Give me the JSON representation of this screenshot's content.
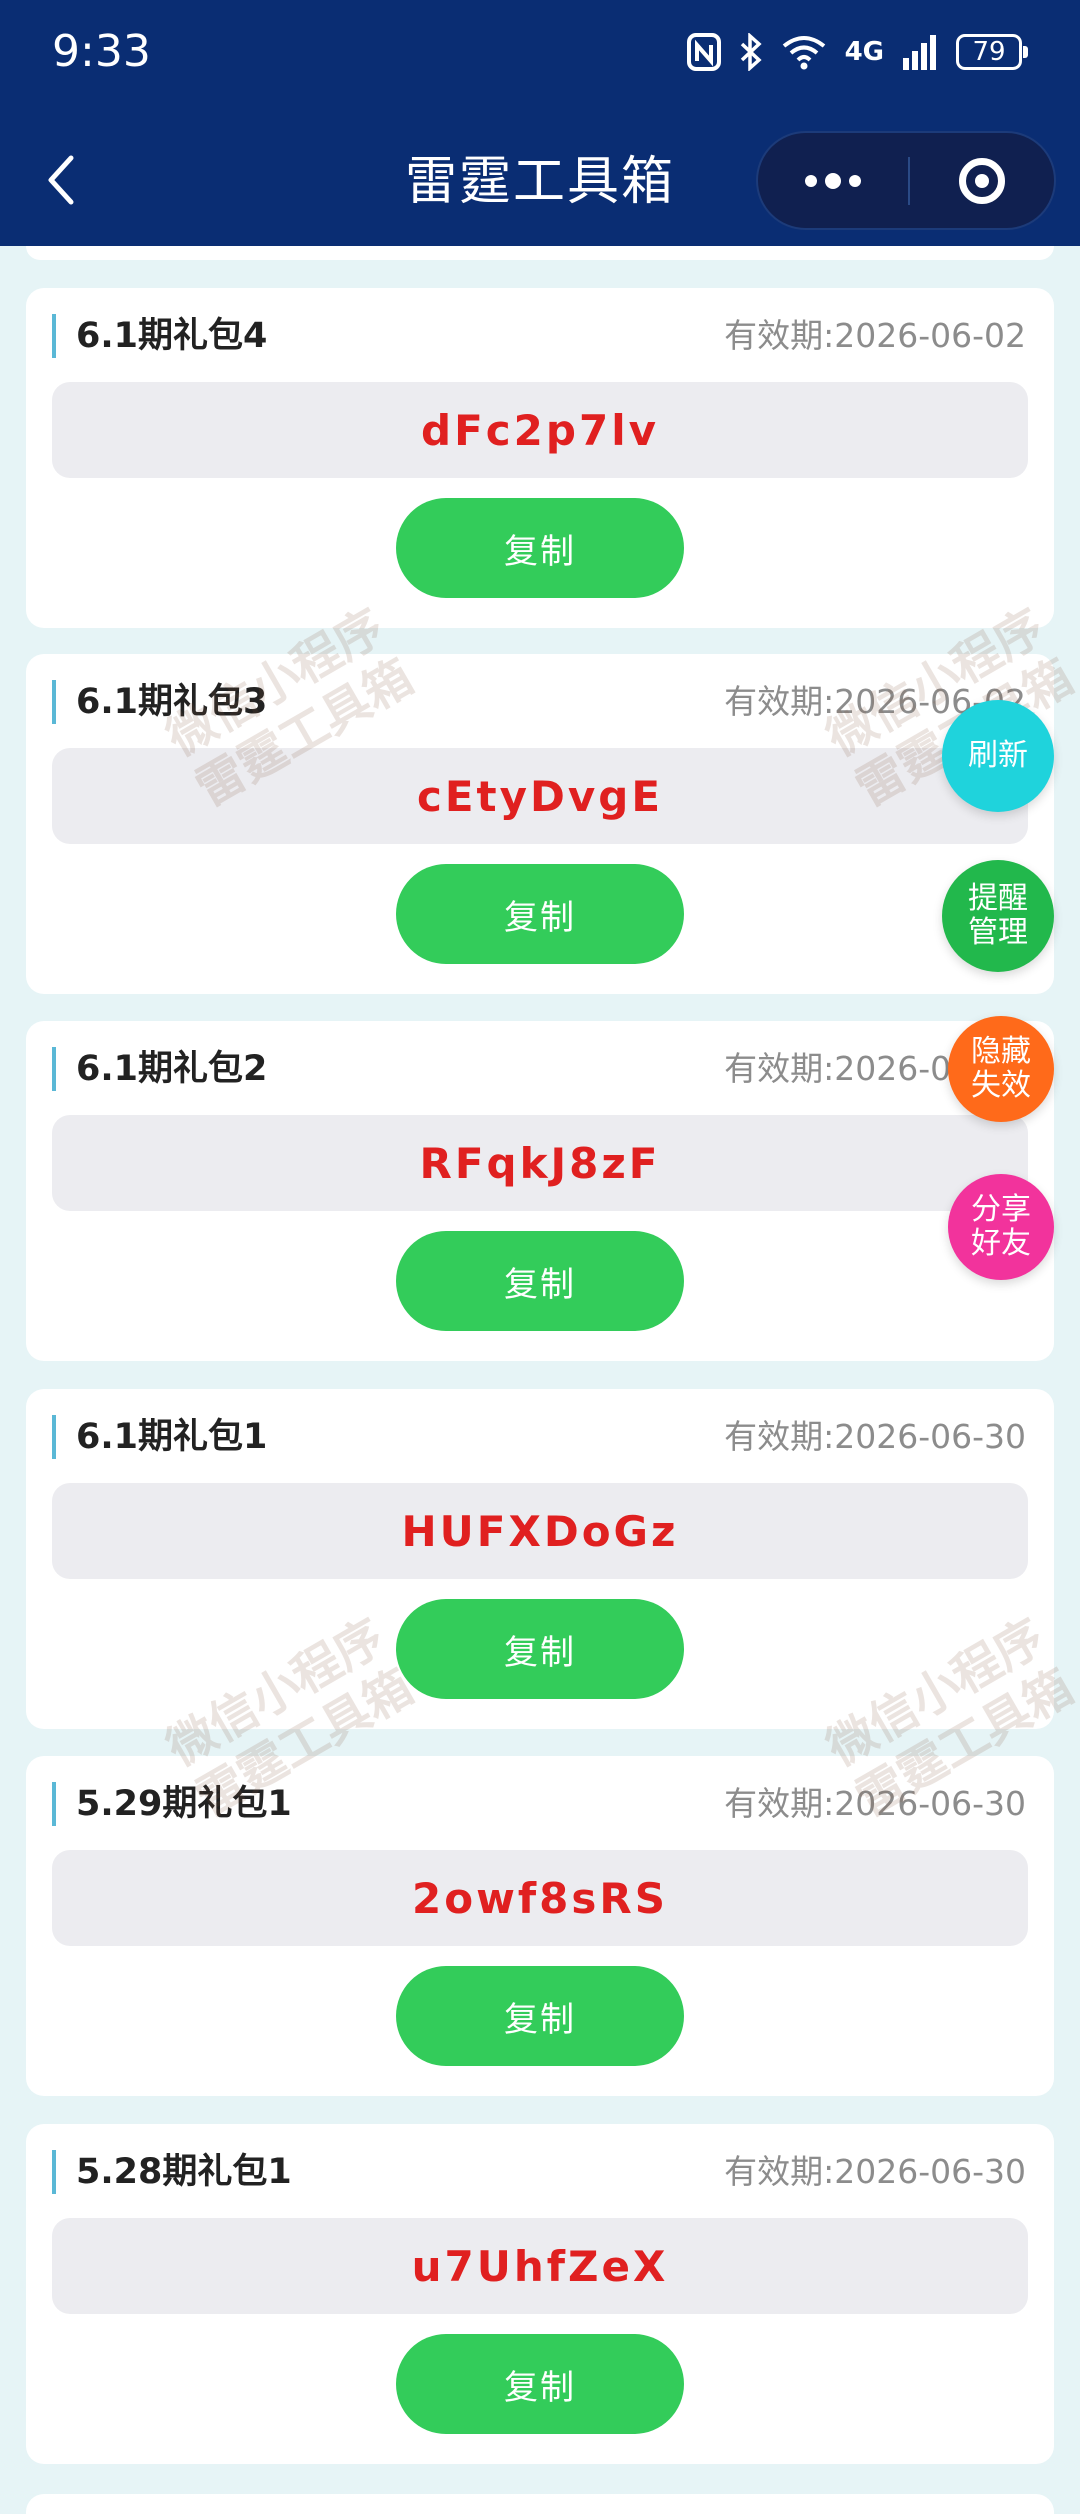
{
  "status_bar": {
    "time": "9:33",
    "network": "4G",
    "battery": "79"
  },
  "nav": {
    "title": "雷霆工具箱"
  },
  "cards": [
    {
      "title": "6.1期礼包4",
      "expiry": "有效期:2026-06-02",
      "code": "dFc2p7lv",
      "copy_label": "复制"
    },
    {
      "title": "6.1期礼包3",
      "expiry": "有效期:2026-06-02",
      "code": "cEtyDvgE",
      "copy_label": "复制"
    },
    {
      "title": "6.1期礼包2",
      "expiry": "有效期:2026-06-30",
      "code": "RFqkJ8zF",
      "copy_label": "复制"
    },
    {
      "title": "6.1期礼包1",
      "expiry": "有效期:2026-06-30",
      "code": "HUFXDoGz",
      "copy_label": "复制"
    },
    {
      "title": "5.29期礼包1",
      "expiry": "有效期:2026-06-30",
      "code": "2owf8sRS",
      "copy_label": "复制"
    },
    {
      "title": "5.28期礼包1",
      "expiry": "有效期:2026-06-30",
      "code": "u7UhfZeX",
      "copy_label": "复制"
    }
  ],
  "floating_buttons": {
    "refresh": {
      "label": "刷新",
      "color": "#1fd3dc"
    },
    "reminder": {
      "label": "提醒管理",
      "color": "#22b84c"
    },
    "hide_expired": {
      "label": "隐藏失效",
      "color": "#ff6a1a"
    },
    "share": {
      "label": "分享好友",
      "color": "#f2339c"
    }
  },
  "watermark": {
    "text": "微信小程序\n雷霆工具箱"
  },
  "colors": {
    "header_bg": "#0a2d73",
    "code_text": "#e02020",
    "copy_button": "#33cc5a",
    "page_bg": "#e6f4f6"
  }
}
